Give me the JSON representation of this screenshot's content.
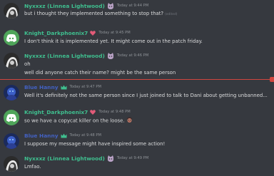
{
  "colors": {
    "background": "#36393f",
    "text": "#dcddde",
    "timestamp": "#8e9297",
    "new_divider": "#d2463f",
    "nyxxxz_name": "#3fbf8f",
    "knight_name": "#3fbf8f",
    "blue_name": "#4361c2",
    "discord_blurple": "#5865f2"
  },
  "messages": [
    {
      "author": "Nyxxxz (Linnea Lightwood)",
      "badge": "cat-emoji-icon",
      "timestamp": "Today at 9:44 PM",
      "lines": [
        "but i thought they implemented something to stop that?"
      ],
      "edited": "(edited)"
    },
    {
      "author": "Knight_Darkphoenix7",
      "badge": "heart-icon",
      "timestamp": "Today at 9:45 PM",
      "lines": [
        "I don't think it is implemented yet. It might come out in the patch friday."
      ]
    },
    {
      "author": "Nyxxxz (Linnea Lightwood)",
      "badge": "cat-emoji-icon",
      "timestamp": "Today at 9:46 PM",
      "lines": [
        "oh",
        "well did anyone catch their name? might be the same person"
      ]
    },
    {
      "author": "Blue Hanny",
      "badge": "crown-icon",
      "timestamp": "Today at 9:47 PM",
      "lines": [
        "Well it's definitely not the same person since I just joined to talk to Dani about getting unbanned..."
      ]
    },
    {
      "author": "Knight_Darkphoenix7",
      "badge": "heart-icon",
      "timestamp": "Today at 9:48 PM",
      "lines": [
        "so we have a copycat killer on the loose."
      ],
      "emoji": "pirate-emoji-icon"
    },
    {
      "author": "Blue Hanny",
      "badge": "crown-icon",
      "timestamp": "Today at 9:48 PM",
      "lines": [
        "I suppose my message might have inspired some action!"
      ]
    },
    {
      "author": "Nyxxxz (Linnea Lightwood)",
      "badge": "cat-emoji-icon",
      "timestamp": "Today at 9:49 PM",
      "lines": [
        "Lmfao."
      ]
    }
  ]
}
